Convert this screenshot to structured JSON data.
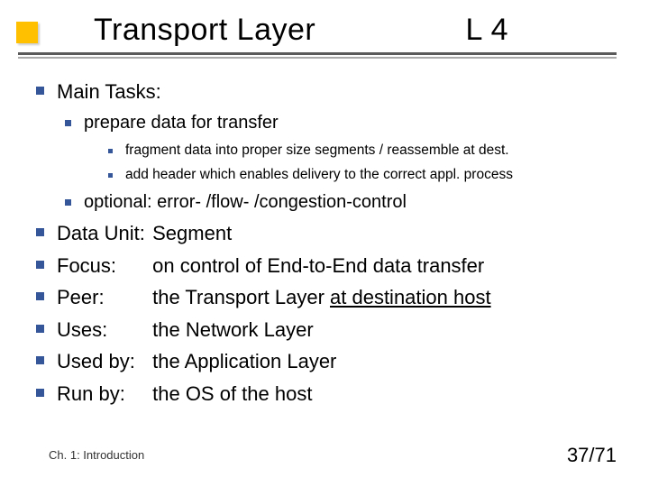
{
  "title": "Transport Layer",
  "title_right": "L 4",
  "main_tasks_label": "Main Tasks:",
  "sub_prepare": "prepare data for transfer",
  "sub_prepare_a": "fragment data into proper size segments / reassemble at dest.",
  "sub_prepare_b": "add header which enables delivery to the correct appl. process",
  "sub_optional": "optional: error- /flow- /congestion-control",
  "rows": [
    {
      "label": "Data Unit:",
      "value": "Segment"
    },
    {
      "label": "Focus:",
      "value": "on control of End-to-End data transfer"
    },
    {
      "label": "Peer:",
      "value_prefix": "the Transport Layer ",
      "value_underlined": "at destination host"
    },
    {
      "label": "Uses:",
      "value": "the Network Layer"
    },
    {
      "label": "Used by:",
      "value": "the Application Layer"
    },
    {
      "label": "Run by:",
      "value": "the OS of the host"
    }
  ],
  "footer_left": "Ch. 1: Introduction",
  "footer_right": "37/71"
}
